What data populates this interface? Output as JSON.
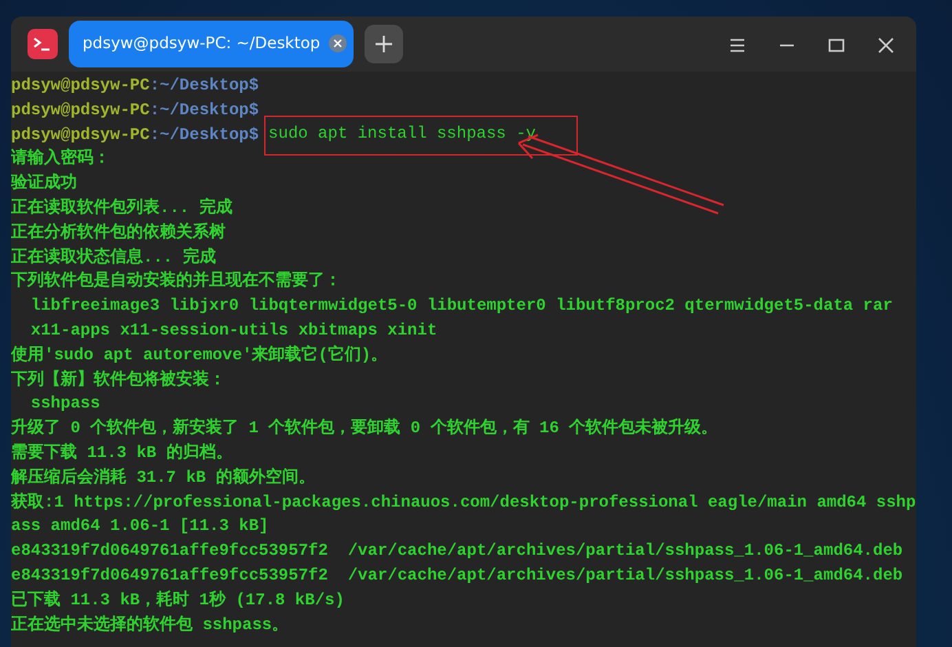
{
  "window": {
    "tabs": [
      {
        "label": "pdsyw@pdsyw-PC: ~/Desktop",
        "selected": true
      }
    ]
  },
  "terminal": {
    "lines": [
      {
        "kind": "prompt",
        "user": "pdsyw@pdsyw-PC",
        "separator": ":",
        "path": "~/Desktop",
        "symbol": "$"
      },
      {
        "kind": "prompt",
        "user": "pdsyw@pdsyw-PC",
        "separator": ":",
        "path": "~/Desktop",
        "symbol": "$"
      },
      {
        "kind": "prompt",
        "user": "pdsyw@pdsyw-PC",
        "separator": ":",
        "path": "~/Desktop",
        "symbol": "$",
        "command": "sudo apt install sshpass -y",
        "highlighted": true
      },
      {
        "kind": "output",
        "text": "请输入密码："
      },
      {
        "kind": "output",
        "text": "验证成功"
      },
      {
        "kind": "output",
        "text": "正在读取软件包列表... 完成"
      },
      {
        "kind": "output",
        "text": "正在分析软件包的依赖关系树"
      },
      {
        "kind": "output",
        "text": "正在读取状态信息... 完成"
      },
      {
        "kind": "output",
        "text": "下列软件包是自动安装的并且现在不需要了："
      },
      {
        "kind": "output",
        "text": "  libfreeimage3 libjxr0 libqtermwidget5-0 libutempter0 libutf8proc2 qtermwidget5-data rar"
      },
      {
        "kind": "output",
        "text": "  x11-apps x11-session-utils xbitmaps xinit"
      },
      {
        "kind": "output",
        "text": "使用'sudo apt autoremove'来卸载它(它们)。"
      },
      {
        "kind": "output",
        "text": "下列【新】软件包将被安装："
      },
      {
        "kind": "output",
        "text": "  sshpass"
      },
      {
        "kind": "output",
        "text": "升级了 0 个软件包，新安装了 1 个软件包，要卸载 0 个软件包，有 16 个软件包未被升级。"
      },
      {
        "kind": "output",
        "text": "需要下载 11.3 kB 的归档。"
      },
      {
        "kind": "output",
        "text": "解压缩后会消耗 31.7 kB 的额外空间。"
      },
      {
        "kind": "output",
        "text": "获取:1 https://professional-packages.chinauos.com/desktop-professional eagle/main amd64 sshp"
      },
      {
        "kind": "output",
        "text": "ass amd64 1.06-1 [11.3 kB]"
      },
      {
        "kind": "output",
        "text": "e843319f7d0649761affe9fcc53957f2  /var/cache/apt/archives/partial/sshpass_1.06-1_amd64.deb"
      },
      {
        "kind": "output",
        "text": "e843319f7d0649761affe9fcc53957f2  /var/cache/apt/archives/partial/sshpass_1.06-1_amd64.deb"
      },
      {
        "kind": "output",
        "text": "已下载 11.3 kB，耗时 1秒 (17.8 kB/s)"
      },
      {
        "kind": "output",
        "text": "正在选中未选择的软件包 sshpass。"
      }
    ]
  }
}
